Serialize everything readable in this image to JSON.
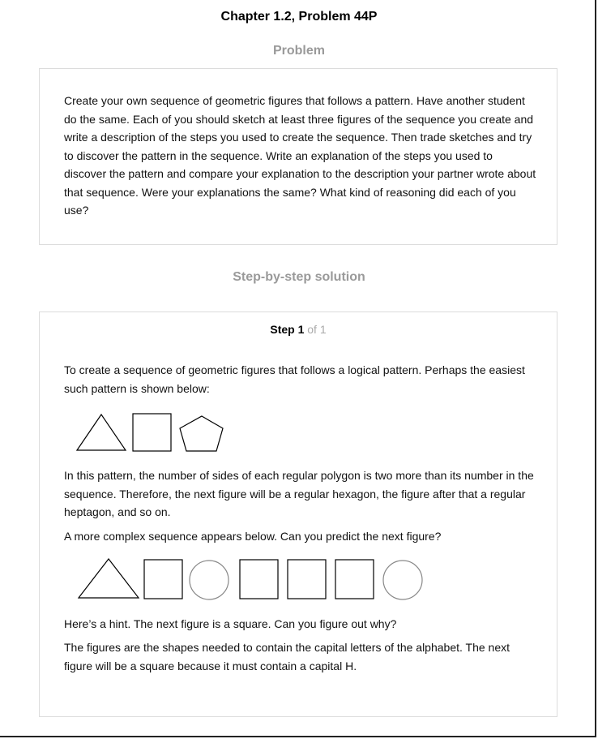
{
  "header": {
    "title": "Chapter 1.2, Problem 44P"
  },
  "problem": {
    "heading": "Problem",
    "text": "Create your own sequence of geometric figures that follows a pattern. Have another student do the same. Each of you should sketch at least three figures of the sequence you create and write a description of the steps you used to create the sequence. Then trade sketches and try to discover the pattern in the sequence. Write an explanation of the steps you used to discover the pattern and compare your explanation to the description your partner wrote about that sequence. Were your explanations the same? What kind of reasoning did each of you use?"
  },
  "solution": {
    "heading": "Step-by-step solution",
    "step_label": "Step 1",
    "step_total": "of 1",
    "paragraphs": [
      "To create a sequence of geometric figures that follows a logical pattern. Perhaps the easiest such pattern is shown below:",
      "In this pattern, the number of sides of each regular polygon is two more than its number in the sequence. Therefore, the next figure will be a regular hexagon, the figure after that a regular heptagon, and so on.",
      "A more complex sequence appears below. Can you predict the next figure?",
      "Here’s a hint. The next figure is a square. Can you figure out why?",
      "The figures are the shapes needed to contain the capital letters of the alphabet. The next figure will be a square because it must contain a capital H."
    ],
    "figure_sequence_1": [
      "triangle",
      "square",
      "pentagon"
    ],
    "figure_sequence_2": [
      "triangle",
      "square",
      "circle",
      "square",
      "square",
      "square",
      "circle"
    ]
  },
  "colors": {
    "heading_gray": "#9a9a9a",
    "border": "#dcdcdc",
    "circle_stroke": "#888888"
  }
}
